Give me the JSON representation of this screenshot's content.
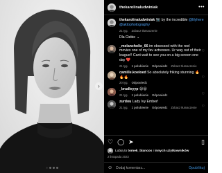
{
  "post": {
    "username": "thekarolinaludwiniak",
    "more_icon": "more-horizontal-icon",
    "caption": {
      "username": "thekarolinaludwiniak",
      "text_before": " 📷 by the incredible ",
      "mention1": "@lilyhere",
      "mention2": "@aktophotography",
      "time": "21 tyg.",
      "translate": "Zobacz tłumaczenie"
    },
    "filter_label": "Dla Ciebie",
    "comments": [
      {
        "username": "_melancholie_66",
        "text": " im obsessed with the reel movies one of my fav actresses. Ur way out of their league!! Cant wait to see you on a big screen one day ",
        "emoji": "❤️",
        "time": "21 tyg.",
        "likes": "1 polubienie",
        "reply": "Odpowiedz",
        "translate": "Zobacz tłumaczenie"
      },
      {
        "username": "camille.koeloed",
        "text": " So absolutely friking stunning ",
        "emoji": "🔥🔥🔥",
        "time": "20 tyg.",
        "likes": "",
        "reply": "Odpowiedz",
        "translate": ""
      },
      {
        "username": "_bradleyyp",
        "text": " ",
        "emoji": "😍😍",
        "time": "21 tyg.",
        "likes": "1 polubienie",
        "reply": "Odpowiedz",
        "translate": ""
      },
      {
        "username": "zurdou",
        "text": " Lady Ivy Ember!",
        "emoji": "",
        "time": "21 tyg.",
        "likes": "1 polubienie",
        "reply": "Odpowiedz",
        "translate": "Zobacz tłumaczenie"
      }
    ],
    "likes": {
      "prefix": "Lubią to ",
      "user": "tomek_blancos",
      "suffix": " i ",
      "others": "innych użytkowników"
    },
    "date": "2 listopada 2023",
    "add_comment": {
      "placeholder": "Dodaj komentarz...",
      "post_label": "Opublikuj"
    },
    "colors": {
      "panel_bg": "#000000",
      "link": "#4fa3f7",
      "heart": "#ff3040"
    }
  }
}
